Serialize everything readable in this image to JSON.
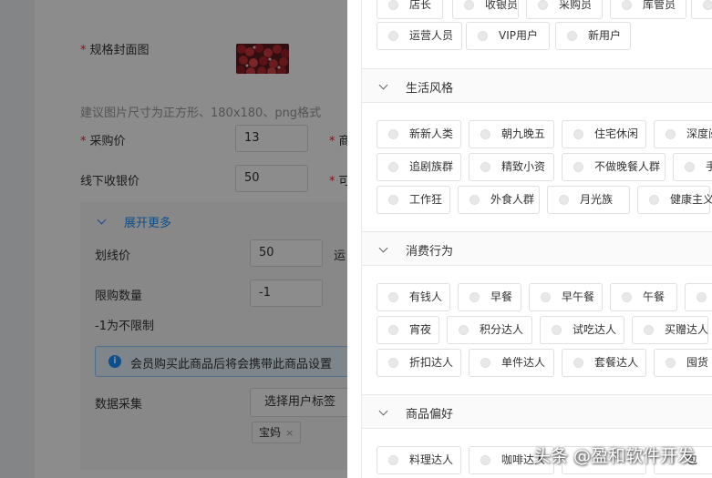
{
  "form": {
    "cover_label": "规格封面图",
    "cover_hint": "建议图片尺寸为正方形、180x180、png格式",
    "purchase_price_label": "采购价",
    "purchase_price_value": "13",
    "right_label_1": "商",
    "offline_price_label": "线下收银价",
    "offline_price_value": "50",
    "right_label_2": "可",
    "expand_more": "展开更多",
    "strike_price_label": "划线价",
    "strike_price_value": "50",
    "right_label_3": "运",
    "limit_label": "限购数量",
    "limit_value": "-1",
    "limit_hint": "-1为不限制",
    "info_text": "会员购买此商品后将会携带此商品设置",
    "data_collect_label": "数据采集",
    "select_tag_button": "选择用户标签",
    "selected_tag": "宝妈",
    "tag_close": "×",
    "required_mark": "*"
  },
  "drawer": {
    "sections": [
      {
        "title": "",
        "rows": [
          [
            "店长",
            "收银员",
            "采购员",
            "库管员",
            ""
          ],
          [
            "运营人员",
            "VIP用户",
            "新用户"
          ]
        ]
      },
      {
        "title": "生活风格",
        "rows": [
          [
            "新新人类",
            "朝九晚五",
            "住宅休闲",
            "深度阅"
          ],
          [
            "追剧族群",
            "精致小资",
            "不做晚餐人群",
            "手"
          ],
          [
            "工作狂",
            "外食人群",
            "月光族",
            "健康主义"
          ]
        ]
      },
      {
        "title": "消费行为",
        "rows": [
          [
            "有钱人",
            "早餐",
            "早午餐",
            "午餐",
            ""
          ],
          [
            "宵夜",
            "积分达人",
            "试吃达人",
            "买赠达人"
          ],
          [
            "折扣达人",
            "单件达人",
            "套餐达人",
            "囤货"
          ]
        ]
      },
      {
        "title": "商品偏好",
        "rows": [
          [
            "料理达人",
            "咖啡达人",
            "",
            "包"
          ]
        ]
      }
    ]
  },
  "watermark": "头条 @盈和软件开发",
  "colors": {
    "accent": "#1890ff",
    "required": "#f5222d",
    "mask": "rgba(0,0,0,0.45)"
  }
}
